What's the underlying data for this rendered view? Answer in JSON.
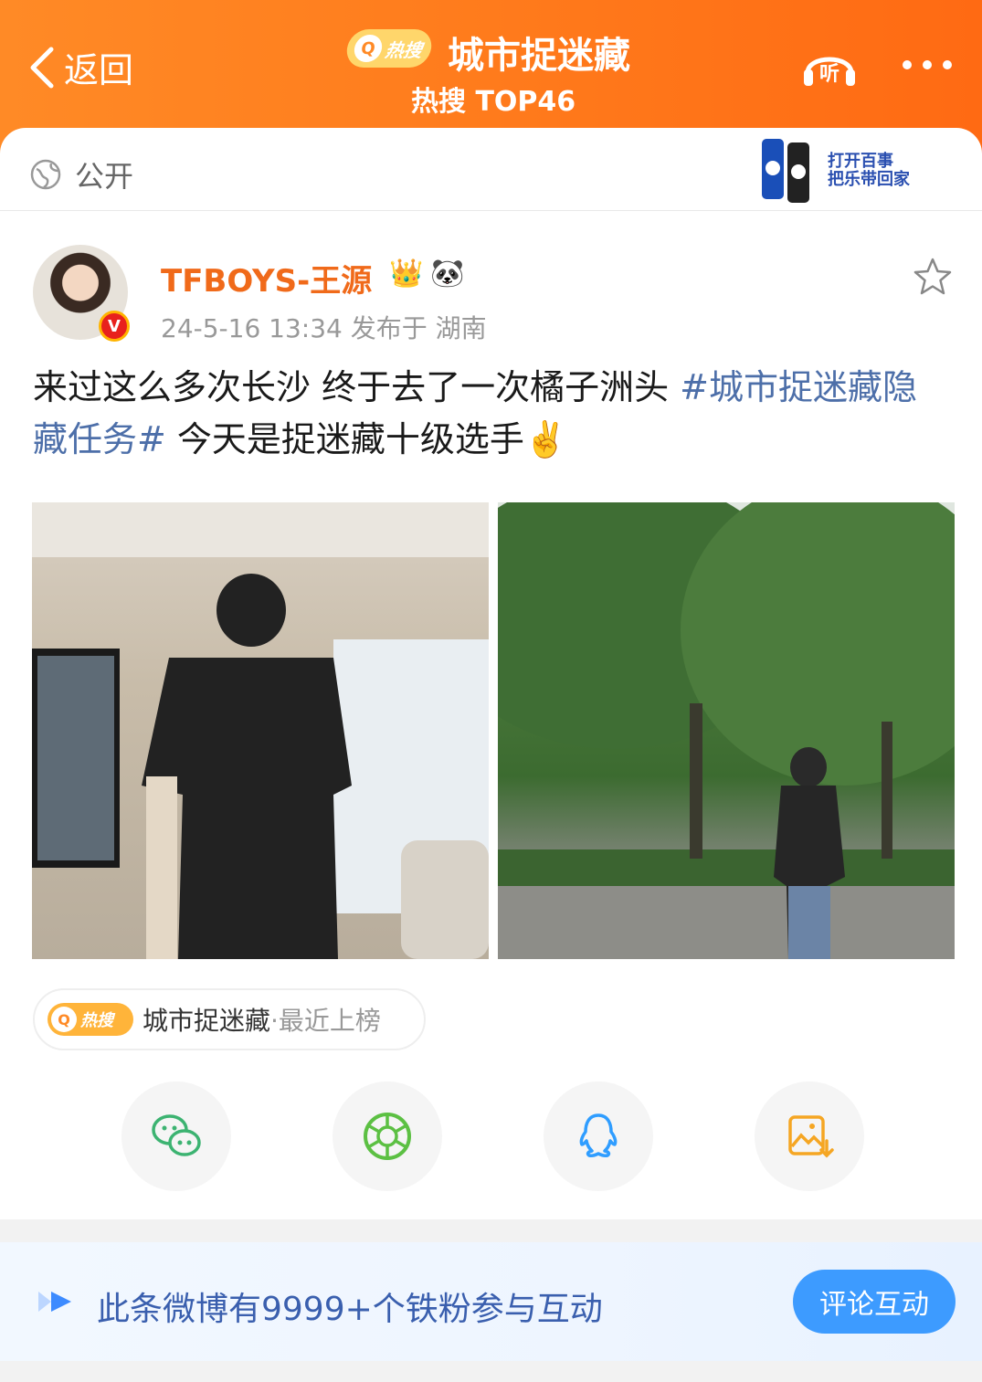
{
  "header": {
    "back_label": "返回",
    "hot_badge": "热搜",
    "title": "城市捉迷藏",
    "subtitle": "热搜 TOP46",
    "listen_label": "听"
  },
  "visibility": {
    "label": "公开"
  },
  "ad": {
    "text_line1": "打开百事",
    "text_line2": "把乐带回家"
  },
  "post": {
    "username": "TFBOYS-王源",
    "badges": [
      "👑",
      "🐼"
    ],
    "meta": "24-5-16 13:34  发布于 湖南",
    "text_prefix": "来过这么多次长沙 终于去了一次橘子洲头 ",
    "hashtag": "#城市捉迷藏隐藏任务#",
    "text_suffix": " 今天是捉迷藏十级选手✌️",
    "verified_badge": "V"
  },
  "hot_tag": {
    "badge": "热搜",
    "name": "城市捉迷藏",
    "status": "·最近上榜"
  },
  "share": {
    "icons": [
      "wechat-icon",
      "moments-icon",
      "qq-icon",
      "save-image-icon"
    ]
  },
  "fans_bar": {
    "text": "此条微博有9999+个铁粉参与互动",
    "button": "评论互动"
  },
  "colors": {
    "header_orange": "#ff7b1c",
    "username_orange": "#f06a1a",
    "hashtag_blue": "#4d6fa9",
    "button_blue": "#3d9bff"
  }
}
